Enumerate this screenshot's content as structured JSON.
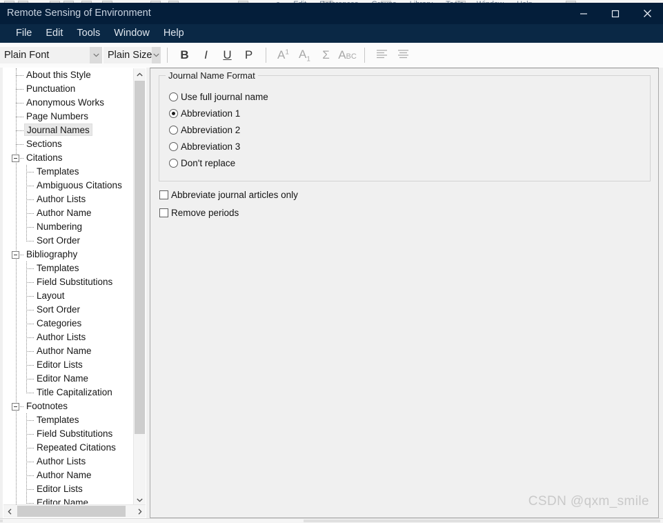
{
  "background_window": {
    "menus": [
      "e",
      "Edit",
      "References",
      "Groups",
      "Library",
      "Tools",
      "Window",
      "Help"
    ]
  },
  "window": {
    "title": "Remote Sensing of Environment",
    "controls": {
      "minimize": "minimize-button",
      "maximize": "maximize-button",
      "close": "close-button"
    },
    "titlebar_color": "#041E3A",
    "menubar_color": "#0A2845"
  },
  "menubar": {
    "items": [
      "File",
      "Edit",
      "Tools",
      "Window",
      "Help"
    ]
  },
  "toolbar": {
    "font_combo": {
      "value": "Plain Font"
    },
    "size_combo": {
      "value": "Plain Size"
    },
    "buttons": [
      {
        "name": "bold-button",
        "label": "B"
      },
      {
        "name": "italic-button",
        "label": "I"
      },
      {
        "name": "underline-button",
        "label": "U"
      },
      {
        "name": "plain-button",
        "label": "P"
      },
      {
        "name": "superscript-button",
        "label": "A",
        "modifier": "1"
      },
      {
        "name": "subscript-button",
        "label": "A",
        "modifier": "1"
      },
      {
        "name": "symbol-button",
        "label": "Σ"
      },
      {
        "name": "small-caps-button",
        "label": "A",
        "modifier": "BC"
      },
      {
        "name": "align-left-button",
        "label": ""
      },
      {
        "name": "align-center-button",
        "label": ""
      }
    ]
  },
  "tree": {
    "selected": "Journal Names",
    "items": [
      {
        "label": "About this Style",
        "level": 1,
        "expander": false
      },
      {
        "label": "Punctuation",
        "level": 1,
        "expander": false
      },
      {
        "label": "Anonymous Works",
        "level": 1,
        "expander": false
      },
      {
        "label": "Page Numbers",
        "level": 1,
        "expander": false
      },
      {
        "label": "Journal Names",
        "level": 1,
        "expander": false,
        "selected": true
      },
      {
        "label": "Sections",
        "level": 1,
        "expander": false
      },
      {
        "label": "Citations",
        "level": 1,
        "expander": true
      },
      {
        "label": "Templates",
        "level": 2,
        "expander": false
      },
      {
        "label": "Ambiguous Citations",
        "level": 2,
        "expander": false
      },
      {
        "label": "Author Lists",
        "level": 2,
        "expander": false
      },
      {
        "label": "Author Name",
        "level": 2,
        "expander": false
      },
      {
        "label": "Numbering",
        "level": 2,
        "expander": false
      },
      {
        "label": "Sort Order",
        "level": 2,
        "expander": false
      },
      {
        "label": "Bibliography",
        "level": 1,
        "expander": true
      },
      {
        "label": "Templates",
        "level": 2,
        "expander": false
      },
      {
        "label": "Field Substitutions",
        "level": 2,
        "expander": false
      },
      {
        "label": "Layout",
        "level": 2,
        "expander": false
      },
      {
        "label": "Sort Order",
        "level": 2,
        "expander": false
      },
      {
        "label": "Categories",
        "level": 2,
        "expander": false
      },
      {
        "label": "Author Lists",
        "level": 2,
        "expander": false
      },
      {
        "label": "Author Name",
        "level": 2,
        "expander": false
      },
      {
        "label": "Editor Lists",
        "level": 2,
        "expander": false
      },
      {
        "label": "Editor Name",
        "level": 2,
        "expander": false
      },
      {
        "label": "Title Capitalization",
        "level": 2,
        "expander": false
      },
      {
        "label": "Footnotes",
        "level": 1,
        "expander": true
      },
      {
        "label": "Templates",
        "level": 2,
        "expander": false
      },
      {
        "label": "Field Substitutions",
        "level": 2,
        "expander": false
      },
      {
        "label": "Repeated Citations",
        "level": 2,
        "expander": false
      },
      {
        "label": "Author Lists",
        "level": 2,
        "expander": false
      },
      {
        "label": "Author Name",
        "level": 2,
        "expander": false
      },
      {
        "label": "Editor Lists",
        "level": 2,
        "expander": false
      },
      {
        "label": "Editor Name",
        "level": 2,
        "expander": false
      }
    ]
  },
  "panel": {
    "groupbox_title": "Journal Name Format",
    "radios": [
      {
        "label": "Use full journal name",
        "checked": false
      },
      {
        "label": "Abbreviation 1",
        "checked": true
      },
      {
        "label": "Abbreviation 2",
        "checked": false
      },
      {
        "label": "Abbreviation 3",
        "checked": false
      },
      {
        "label": "Don't replace",
        "checked": false
      }
    ],
    "checkboxes": [
      {
        "label": "Abbreviate journal articles only",
        "checked": false
      },
      {
        "label": "Remove periods",
        "checked": false
      }
    ]
  },
  "watermark": "CSDN @qxm_smile"
}
